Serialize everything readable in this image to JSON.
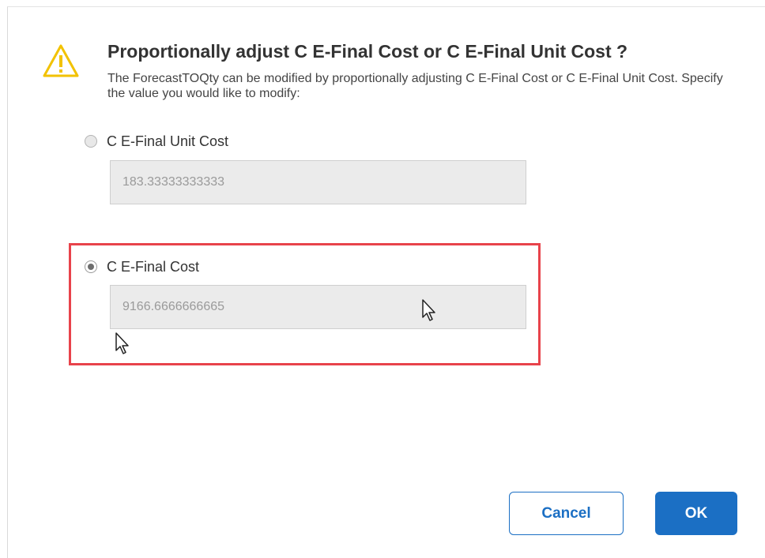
{
  "dialog": {
    "title": "Proportionally adjust C E-Final Cost or C E-Final Unit Cost ?",
    "description": "The ForecastTOQty can be modified by proportionally adjusting C E-Final Cost or C E-Final Unit Cost. Specify the value you would like to modify:",
    "icon": "warning-triangle-icon",
    "options": [
      {
        "label": "C E-Final Unit Cost",
        "value": "183.33333333333",
        "selected": false
      },
      {
        "label": "C E-Final Cost",
        "value": "9166.6666666665",
        "selected": true
      }
    ],
    "buttons": {
      "cancel_label": "Cancel",
      "ok_label": "OK"
    }
  },
  "colors": {
    "accent": "#1b6fc4",
    "highlight": "#e8434b",
    "warning": "#f2c200"
  }
}
